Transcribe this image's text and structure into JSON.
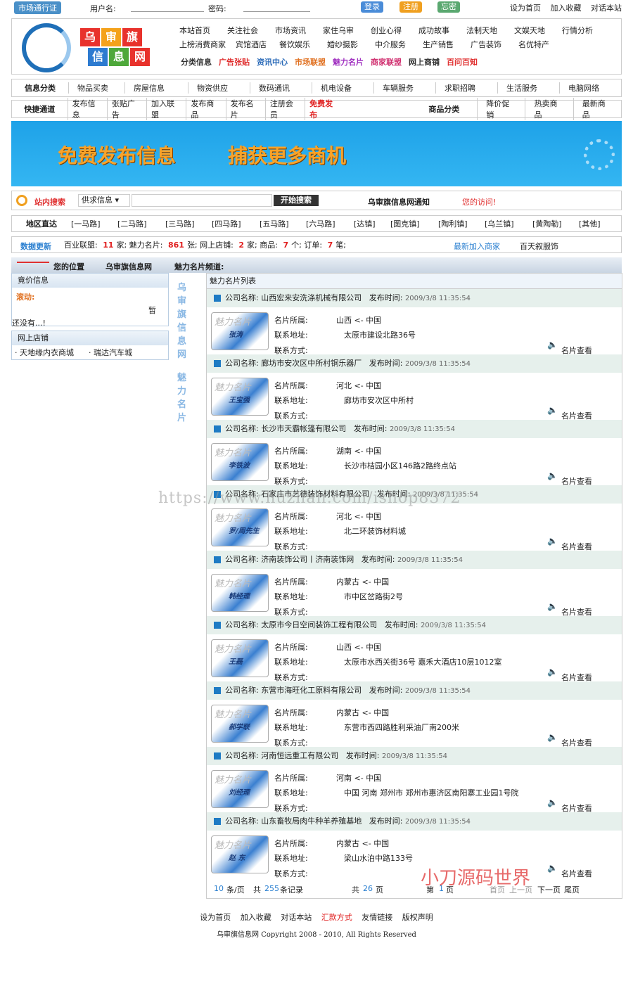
{
  "top": {
    "pass": "市场通行证",
    "user_label": "用户名:",
    "pass_label": "密码:",
    "login": "登录",
    "register": "注册",
    "forgot": "忘密",
    "links": [
      "设为首页",
      "加入收藏",
      "对话本站"
    ]
  },
  "logo": [
    "乌",
    "审",
    "旗",
    "信",
    "息",
    "网"
  ],
  "nav": {
    "row1": [
      "本站首页",
      "关注社会",
      "市场资讯",
      "家住乌审",
      "创业心得",
      "成功故事",
      "法制天地",
      "文娱天地",
      "行情分析"
    ],
    "row2": [
      "上榜消费商家",
      "宾馆酒店",
      "餐饮娱乐",
      "婚纱摄影",
      "中介服务",
      "生产销售",
      "广告装饰",
      "名优特产"
    ],
    "icons": [
      "分类信息",
      "广告张贴",
      "资讯中心",
      "市场联盟",
      "魅力名片",
      "商家联盟",
      "网上商铺",
      "百问百知"
    ]
  },
  "cat_bar": {
    "head": "信息分类",
    "items": [
      "物品买卖",
      "房屋信息",
      "物资供应",
      "数码通讯",
      "机电设备",
      "车辆服务",
      "求职招聘",
      "生活服务",
      "电脑网络"
    ]
  },
  "quick_bar": {
    "head": "快捷通道",
    "items": [
      "发布信息",
      "张贴广告",
      "加入联盟",
      "发布商品",
      "发布名片",
      "注册会员"
    ],
    "free": "免费发布",
    "goods_head": "商品分类",
    "goods": [
      "降价促销",
      "热卖商品",
      "最新商品"
    ]
  },
  "banner": {
    "t1": "免费发布信息",
    "t2": "捕获更多商机"
  },
  "search": {
    "label": "站内搜索",
    "select": "供求信息",
    "button": "开始搜索",
    "notice": "乌审旗信息网通知",
    "welcome": "您的访问!"
  },
  "area": {
    "head": "地区直达",
    "items": [
      "[一马路]",
      "[二马路]",
      "[三马路]",
      "[四马路]",
      "[五马路]",
      "[六马路]",
      "[达镇]",
      "[图克镇]",
      "[陶利镇]",
      "[乌兰镇]",
      "[黄陶勒]",
      "[其他]"
    ]
  },
  "data": {
    "head": "数据更新",
    "league": "百业联盟:",
    "league_n": "11",
    "league_u": "家;",
    "card": "魅力名片:",
    "card_n": "861",
    "card_u": "张;",
    "shop": "网上店铺:",
    "shop_n": "2",
    "shop_u": "家;",
    "goods": "商品:",
    "goods_n": "7",
    "goods_u": "个;",
    "order": "订单:",
    "order_n": "7",
    "order_u": "笔;",
    "newest": "最新加入商家",
    "newest_name": "百天叙服饰"
  },
  "crumb": {
    "label": "您的位置",
    "site": "乌审旗信息网",
    "channel": "魅力名片频道:"
  },
  "side": {
    "bid": "竟价信息",
    "scroll": "滚动:",
    "none": "还没有...!",
    "zan": "暂",
    "shop_head": "网上店铺",
    "shops": [
      "天地缘内衣商城",
      "瑞达汽车城"
    ],
    "vertical1": "乌审旗信息网",
    "vertical2": "魅力名片"
  },
  "main": {
    "title": "魅力名片列表",
    "co_label": "公司名称:",
    "time_label": "发布时间:",
    "fields": [
      "名片所属:",
      "联系地址:",
      "联系方式:"
    ],
    "view": "名片查看",
    "thumb_title": "魅力名片",
    "arrow": "<-",
    "cards": [
      {
        "name": "山西宏来安洗涤机械有限公司",
        "time": "2009/3/8 11:35:54",
        "prov": "山西",
        "country": "中国",
        "addr": "太原市建设北路36号",
        "person": "张涛"
      },
      {
        "name": "廊坊市安次区中所村铜乐器厂",
        "time": "2009/3/8 11:35:54",
        "prov": "河北",
        "country": "中国",
        "addr": "廊坊市安次区中所村",
        "person": "王宝强"
      },
      {
        "name": "长沙市天霸帐篷有限公司",
        "time": "2009/3/8 11:35:54",
        "prov": "湖南",
        "country": "中国",
        "addr": "长沙市桔园小区146路2路终点站",
        "person": "李铁波"
      },
      {
        "name": "石家庄市艺德装饰材料有限公司",
        "time": "2009/3/8 11:35:54",
        "prov": "河北",
        "country": "中国",
        "addr": "北二环装饰材料城",
        "person": "罗/周先生"
      },
      {
        "name": "济南装饰公司丨济南装饰网",
        "time": "2009/3/8 11:35:54",
        "prov": "内蒙古",
        "country": "中国",
        "addr": "市中区岔路街2号",
        "person": "韩经理"
      },
      {
        "name": "太原市今日空间装饰工程有限公司",
        "time": "2009/3/8 11:35:54",
        "prov": "山西",
        "country": "中国",
        "addr": "太原市水西关街36号 嘉禾大酒店10层1012室",
        "person": "王磊"
      },
      {
        "name": "东营市海旺化工原料有限公司",
        "time": "2009/3/8 11:35:54",
        "prov": "内蒙古",
        "country": "中国",
        "addr": "东营市西四路胜利采油厂南200米",
        "person": "郝学联"
      },
      {
        "name": "河南恒远重工有限公司",
        "time": "2009/3/8 11:35:54",
        "prov": "河南",
        "country": "中国",
        "addr": "中国 河南 郑州市 郑州市惠济区南阳寨工业园1号院",
        "person": "刘经理"
      },
      {
        "name": "山东畜牧局肉牛种羊养殖基地",
        "time": "2009/3/8 11:35:54",
        "prov": "内蒙古",
        "country": "中国",
        "addr": "梁山水泊中路133号",
        "person": "赵 东"
      }
    ],
    "pager": {
      "per": "10",
      "per_u": "条/页",
      "total_l": "共",
      "total": "255",
      "total_u": "条记录",
      "pages_l": "共",
      "pages": "26",
      "pages_u": "页",
      "cur_l": "第",
      "cur": "1",
      "cur_u": "页",
      "first": "首页",
      "prev": "上一页",
      "next": "下一页",
      "last": "尾页"
    }
  },
  "footer": {
    "links": [
      "设为首页",
      "加入收藏",
      "对话本站",
      "汇款方式",
      "友情链接",
      "版权声明"
    ],
    "copy": "乌审旗信息网 Copyright 2008 - 2010, All Rights Reserved"
  },
  "watermark": "https://www.huzhan.com/ishop8372",
  "signature": "小刀源码世界"
}
